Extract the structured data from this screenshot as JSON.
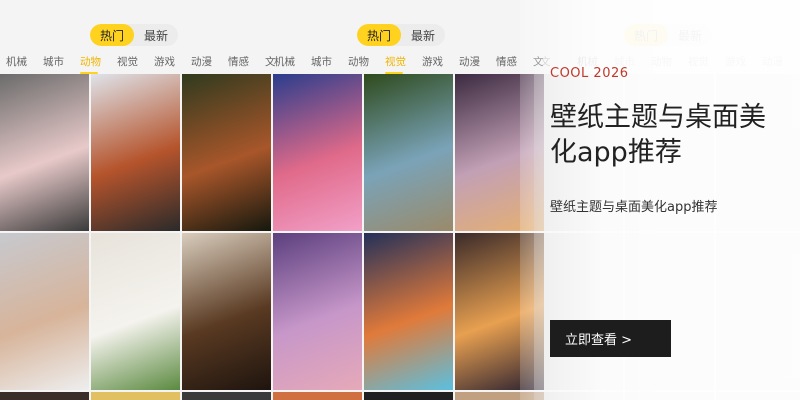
{
  "toggle_left": {
    "active": "热门",
    "inactive": "最新"
  },
  "toggle_mid": {
    "active": "热门",
    "inactive": "最新"
  },
  "toggle_right": {
    "active": "热门",
    "inactive": "最新"
  },
  "tabs_left": [
    "机械",
    "城市",
    "动物",
    "视觉",
    "游戏",
    "动漫",
    "情感",
    "文"
  ],
  "tabs_mid": [
    "机械",
    "城市",
    "动物",
    "视觉",
    "游戏",
    "动漫",
    "情感",
    "文"
  ],
  "tabs_right": [
    "文",
    "机械",
    "城市",
    "动物",
    "视觉",
    "游戏",
    "动漫",
    "情感"
  ],
  "hero": {
    "tagline": "COOL 2026",
    "headline": "壁纸主题与桌面美化app推荐",
    "subtitle": "壁纸主题与桌面美化app推荐",
    "cta": "立即查看 >"
  },
  "tiles": [
    {
      "name": "plush-toys-photo",
      "colors": [
        "#6b6b6b",
        "#e8c9c9",
        "#3a3a3a"
      ]
    },
    {
      "name": "red-panda-snow-photo",
      "colors": [
        "#dfe3ea",
        "#b5542c",
        "#2a2a2a"
      ]
    },
    {
      "name": "red-panda-tree-photo",
      "colors": [
        "#2f3a1e",
        "#a8562a",
        "#15180e"
      ]
    },
    {
      "name": "sunset-planet-art",
      "colors": [
        "#2a3d8c",
        "#e06a8a",
        "#f2a0c8"
      ]
    },
    {
      "name": "river-aerial-photo",
      "colors": [
        "#2e4a1c",
        "#7aa3b8",
        "#9a8a6a"
      ]
    },
    {
      "name": "doorway-stairs-art",
      "colors": [
        "#3b2a40",
        "#c2a0b5",
        "#e6b070"
      ]
    },
    {
      "name": "cat-blanket-photo",
      "colors": [
        "#c7c9cf",
        "#d7b49a",
        "#eeeeee"
      ]
    },
    {
      "name": "puppy-frog-hat-photo",
      "colors": [
        "#e7e3db",
        "#f5f3ee",
        "#5b8a40"
      ]
    },
    {
      "name": "dog-closeup-photo",
      "colors": [
        "#d9cdbd",
        "#5a3a22",
        "#1e140e"
      ]
    },
    {
      "name": "pink-moon-art",
      "colors": [
        "#5b3f7e",
        "#c797c9",
        "#e6a9b8"
      ]
    },
    {
      "name": "abstract-rainbow-art",
      "colors": [
        "#23305a",
        "#e07a3a",
        "#5ac0e0"
      ]
    },
    {
      "name": "ocean-sunset-photo",
      "colors": [
        "#3a2a2a",
        "#e8a050",
        "#2a2030"
      ]
    },
    {
      "name": "strip-1",
      "colors": [
        "#3b2d27",
        "#3b2d27",
        "#3b2d27"
      ]
    },
    {
      "name": "strip-2",
      "colors": [
        "#e0c060",
        "#e0c060",
        "#e0c060"
      ]
    },
    {
      "name": "strip-3",
      "colors": [
        "#3a3a3a",
        "#3a3a3a",
        "#3a3a3a"
      ]
    },
    {
      "name": "strip-4",
      "colors": [
        "#d07040",
        "#d07040",
        "#d07040"
      ]
    },
    {
      "name": "strip-5",
      "colors": [
        "#202020",
        "#202020",
        "#202020"
      ]
    },
    {
      "name": "strip-6",
      "colors": [
        "#c0a080",
        "#c0a080",
        "#c0a080"
      ]
    }
  ]
}
